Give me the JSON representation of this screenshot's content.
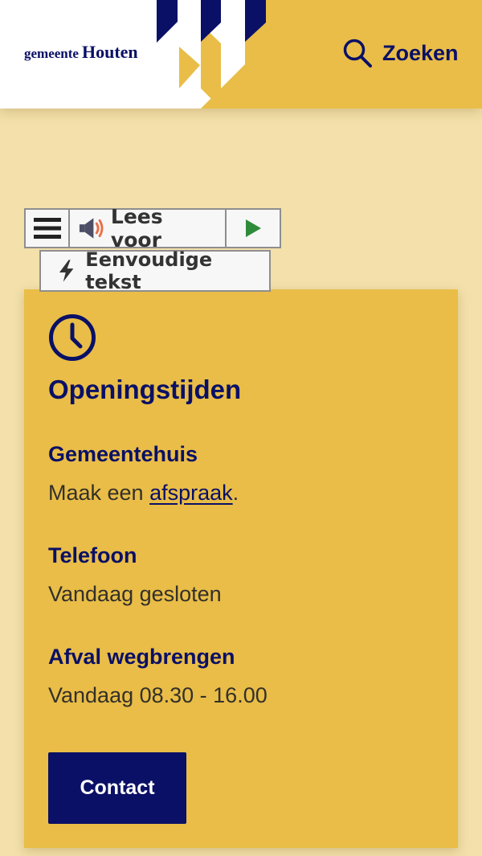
{
  "header": {
    "logo_prefix": "gemeente",
    "logo_name": "Houten",
    "search_label": "Zoeken",
    "search_icon": "search-icon"
  },
  "read_speaker": {
    "menu_icon": "hamburger-menu-icon",
    "read_label": "Lees voor",
    "read_icon": "speaker-icon",
    "play_icon": "play-icon",
    "simple_label": "Eenvoudige tekst",
    "simple_icon": "lightning-icon"
  },
  "opening_hours": {
    "icon": "clock-icon",
    "title": "Openingstijden",
    "sections": [
      {
        "title": "Gemeentehuis",
        "text_before": "Maak een",
        "link": "afspraak",
        "text_after": "."
      },
      {
        "title": "Telefoon",
        "text": "Vandaag gesloten"
      },
      {
        "title": "Afval wegbrengen",
        "text": "Vandaag 08.30 - 16.00"
      }
    ],
    "contact_button": "Contact"
  },
  "colors": {
    "navy": "#0a1066",
    "yellow": "#e9bd47",
    "light_yellow": "#f3e0aa",
    "play_green": "#2e8b3a",
    "speaker_orange": "#e8704a"
  }
}
